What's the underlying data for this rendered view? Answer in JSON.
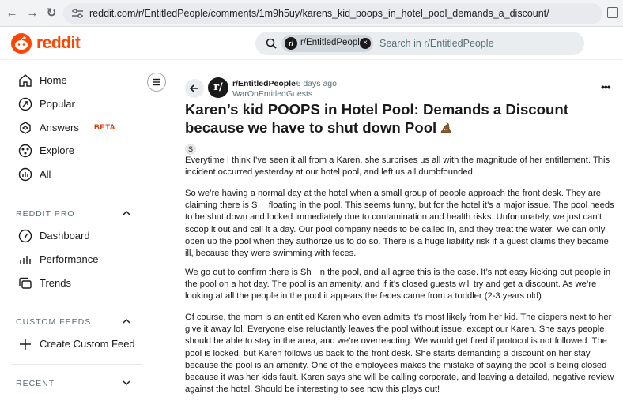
{
  "browser": {
    "url": "reddit.com/r/EntitledPeople/comments/1m9h5uy/karens_kid_poops_in_hotel_pool_demands_a_discount/",
    "back_glyph": "←",
    "forward_glyph": "→",
    "reload_glyph": "↻"
  },
  "header": {
    "logo_text": "reddit",
    "search_chip_label": "r/EntitledPeople",
    "search_chip_avatar": "r/",
    "search_chip_close": "×",
    "search_placeholder": "Search in r/EntitledPeople",
    "brand_color": "#ff4500"
  },
  "sidebar": {
    "items": [
      {
        "label": "Home",
        "icon": "home-icon"
      },
      {
        "label": "Popular",
        "icon": "popular-icon"
      },
      {
        "label": "Answers",
        "icon": "answers-icon",
        "badge": "BETA"
      },
      {
        "label": "Explore",
        "icon": "explore-icon"
      },
      {
        "label": "All",
        "icon": "all-icon"
      }
    ],
    "pro_title": "REDDIT PRO",
    "pro_items": [
      {
        "label": "Dashboard",
        "icon": "dashboard-icon"
      },
      {
        "label": "Performance",
        "icon": "performance-icon"
      },
      {
        "label": "Trends",
        "icon": "trends-icon"
      }
    ],
    "feeds_title": "CUSTOM FEEDS",
    "create_feed_label": "Create Custom Feed",
    "recent_title": "RECENT"
  },
  "post": {
    "subreddit": "r/EntitledPeople",
    "subreddit_avatar": "r/",
    "time": "• 6 days ago",
    "author": "WarOnEntitledGuests",
    "more": "•••",
    "title": "Karen’s kid POOPS in Hotel Pool: Demands a Discount because we have to shut down Pool",
    "badge": "S",
    "paragraphs": [
      "Everytime I think I’ve seen it all from a Karen, she surprises us all with the magnitude of her entitlement. This incident occurred yesterday at our hotel pool, and left us all dumbfounded.",
      "So we’re having a normal day at the hotel when a small group of people approach the front desk. They are claiming there is S   floating in the pool. This seems funny, but for the hotel it’s a major issue. The pool needs to be shut down and locked immediately due to contamination and health risks. Unfortunately, we just can’t scoop it out and call it a day. Our pool company needs to be called in, and they treat the water. We can only open up the pool when they authorize us to do so. There is a huge liability risk if a guest claims they became ill, because they were swimming with feces.",
      "We go out to confirm there is Sh  in the pool, and all agree this is the case. It’s not easy kicking out people in the pool on a hot day. The pool is an amenity, and if it’s closed guests will try and get a discount. As we’re looking at all the people in the pool it appears the feces came from a toddler (2-3 years old)",
      "Of course, the mom is an entitled Karen who even admits it’s most likely from her kid. The diapers next to her give it away lol. Everyone else reluctantly leaves the pool without issue, except our Karen. She says people should be able to stay in the area, and we’re overreacting. We would get fired if protocol is not followed. The pool is locked, but Karen follows us back to the front desk. She starts demanding a discount on her stay because the pool is an amenity. One of the employees makes the mistake of saying the pool is being closed because it was her kids fault. Karen says she will be calling corporate, and leaving a detailed, negative review against the hotel. Should be interesting to see how this plays out!"
    ]
  }
}
